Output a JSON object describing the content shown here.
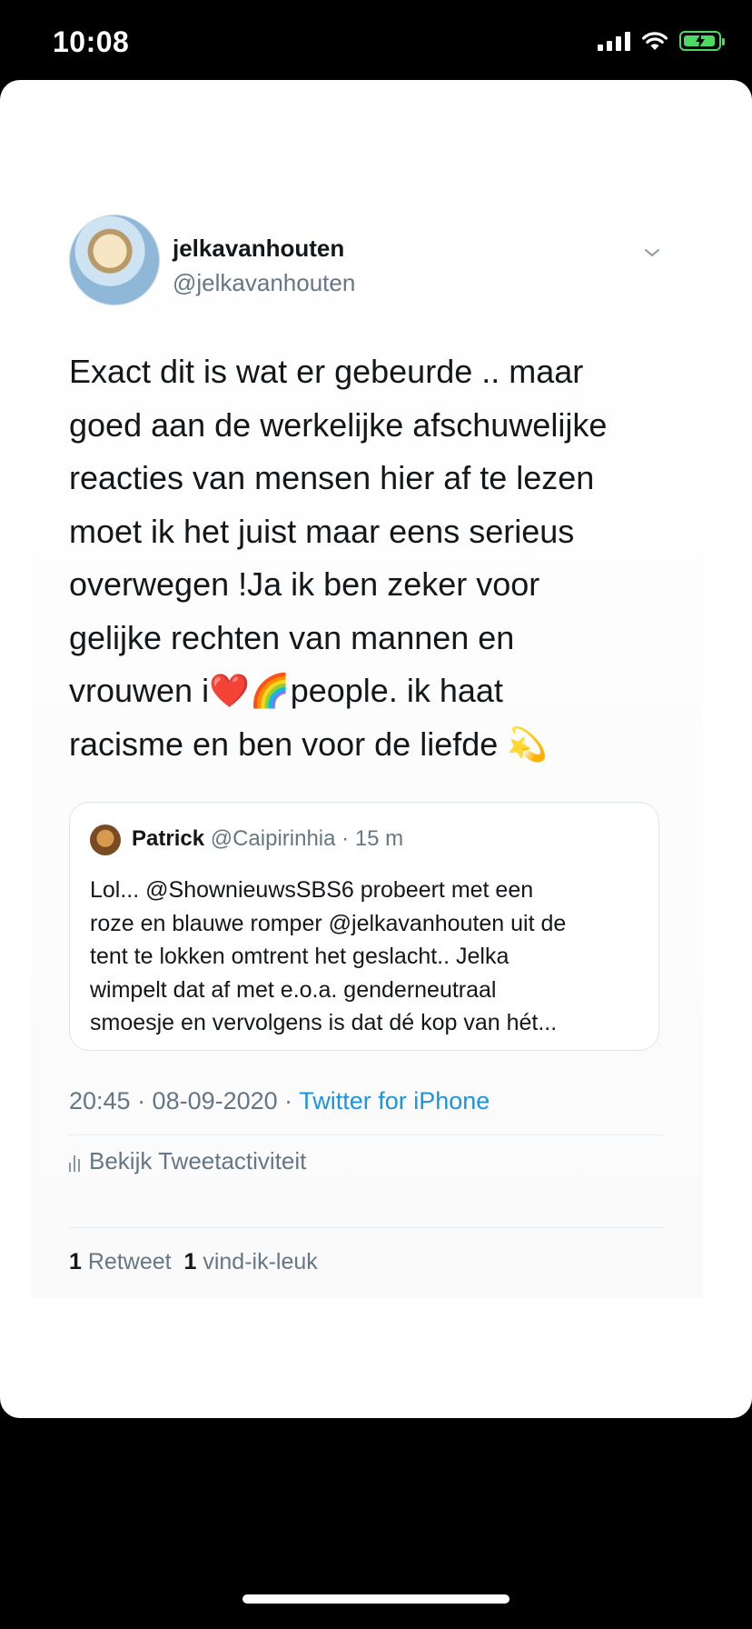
{
  "status_bar": {
    "time": "10:08"
  },
  "tweet": {
    "display_name": "jelkavanhouten",
    "handle": "@jelkavanhouten",
    "text": "Exact dit is wat er gebeurde .. maar\ngoed aan de werkelijke afschuwelijke\nreacties van mensen hier af te lezen\nmoet ik het juist maar eens serieus\noverwegen !Ja ik ben zeker voor\ngelijke  rechten van mannen en\nvrouwen i❤️🌈people.  ik haat\nracisme en ben voor de liefde 💫",
    "timestamp": "20:45 · 08-09-2020 · ",
    "source": "Twitter for iPhone",
    "activity_label": "Bekijk Tweetactiviteit",
    "retweet_count": "1",
    "retweet_label": "Retweet",
    "like_count": "1",
    "like_label": "vind-ik-leuk"
  },
  "quoted_tweet": {
    "name": "Patrick",
    "handle_time": "@Caipirinhia · 15 m",
    "text": "Lol... @ShownieuwsSBS6 probeert met een\nroze en blauwe romper @jelkavanhouten uit de\ntent te lokken omtrent het geslacht.. Jelka\nwimpelt dat af met e.o.a. genderneutraal\nsmoesje en vervolgens is dat dé kop van hét..."
  },
  "icons": {
    "signal": "cellular-signal-icon",
    "wifi": "wifi-icon",
    "battery": "battery-charging-icon",
    "chevron": "chevron-down-icon",
    "activity": "bar-chart-icon"
  },
  "colors": {
    "link": "#1b95e0",
    "secondary": "#657786",
    "battery": "#4cd964"
  }
}
